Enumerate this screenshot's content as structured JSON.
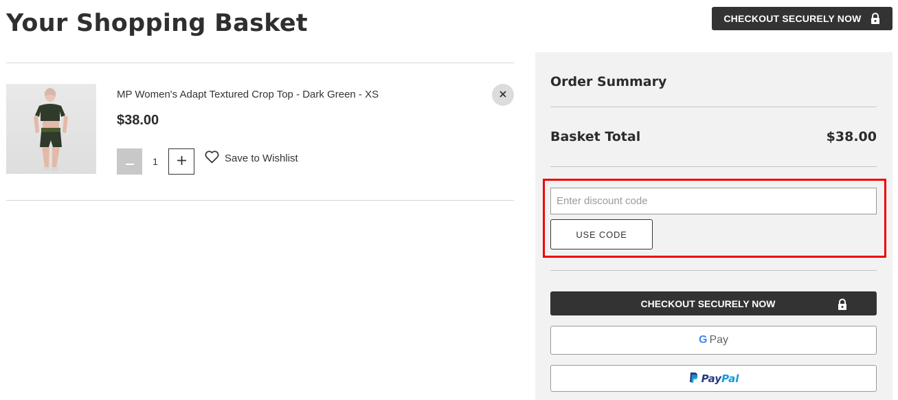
{
  "header": {
    "title": "Your Shopping Basket",
    "checkout_label": "CHECKOUT SECURELY NOW"
  },
  "basket": {
    "items": [
      {
        "name": "MP Women's Adapt Textured Crop Top - Dark Green - XS",
        "price": "$38.00",
        "quantity": "1",
        "wishlist_label": "Save to Wishlist",
        "minus_symbol": "−",
        "plus_symbol": "+",
        "remove_symbol": "✕"
      }
    ]
  },
  "summary": {
    "title": "Order Summary",
    "total_label": "Basket Total",
    "total_value": "$38.00",
    "discount_placeholder": "Enter discount code",
    "discount_value": "",
    "use_code_label": "USE CODE",
    "checkout_label": "CHECKOUT SECURELY NOW",
    "gpay_label": "Pay",
    "gpay_g": "G",
    "paypal_part1": "Pay",
    "paypal_part2": "Pal"
  },
  "colors": {
    "dark_button": "#333333",
    "summary_bg": "#f2f2f2",
    "highlight": "#ee0000",
    "paypal_dark": "#253b80",
    "paypal_light": "#179bd7"
  }
}
